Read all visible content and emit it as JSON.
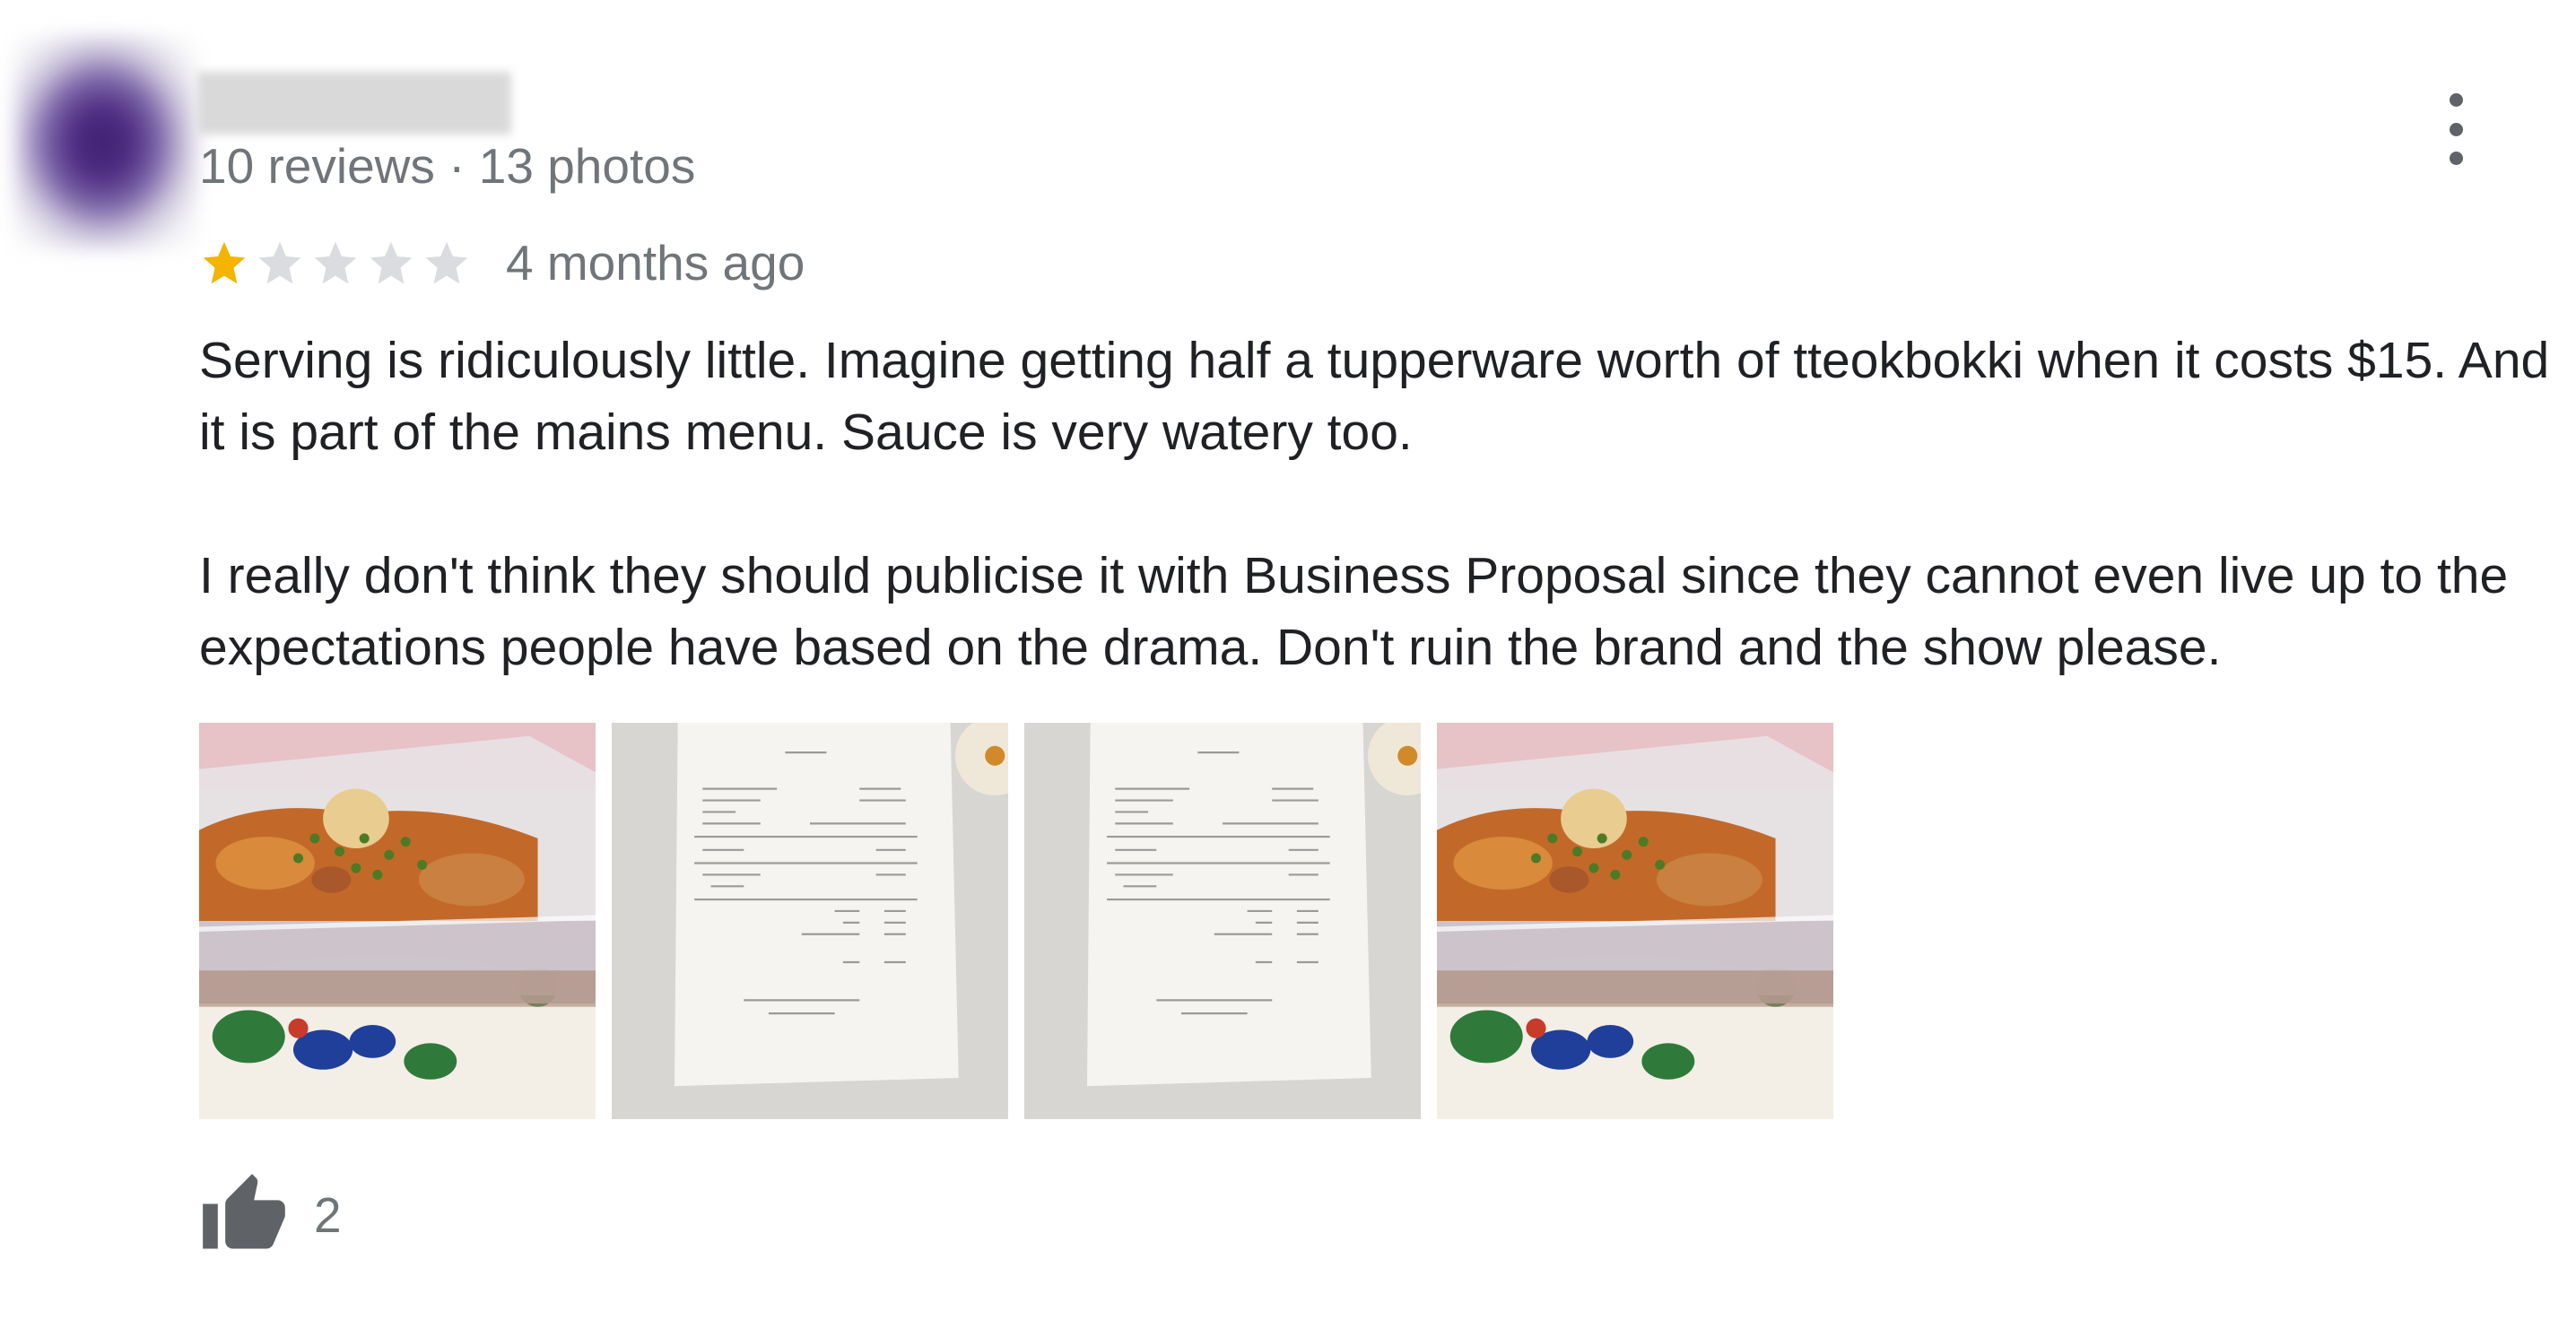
{
  "review": {
    "meta": "10 reviews · 13 photos",
    "rating": 1,
    "rating_max": 5,
    "time_ago": "4 months ago",
    "paragraphs": [
      "Serving is ridiculously little. Imagine getting half a tupperware worth of tteokbokki when it costs $15. And it is part of the mains menu. Sauce is very watery too.",
      "I really don't think they should publicise it with Business Proposal since they cannot even live up to the expectations people have based on the drama. Don't ruin the brand and the show please."
    ],
    "photos": [
      {
        "subject": "tteokbokki-container"
      },
      {
        "subject": "receipt"
      },
      {
        "subject": "receipt"
      },
      {
        "subject": "tteokbokki-container"
      }
    ],
    "likes": "2"
  },
  "icons": {
    "menu": "more-vert-icon",
    "star": "star-icon",
    "like": "thumb-up-icon"
  },
  "colors": {
    "star_filled": "#f4b400",
    "star_empty": "#dadce0",
    "secondary_text": "#70757a",
    "primary_text": "#202124"
  }
}
